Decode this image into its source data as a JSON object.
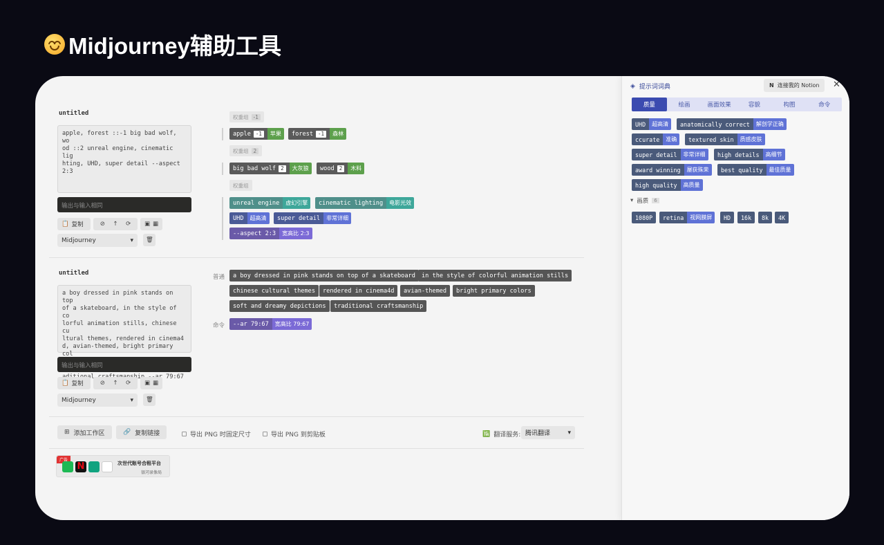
{
  "page_title": "Midjourney辅助工具",
  "colors": {
    "accent": "#3b4bb0",
    "green": "#5da04c",
    "teal": "#3ea79a",
    "blue": "#5f72d6",
    "purple": "#7b6ad6"
  },
  "blocks": [
    {
      "title": "untitled",
      "text": "apple, forest ::-1 big bad wolf, wo\nod ::2 unreal engine, cinematic lig\nhting, UHD, super detail --aspect\n2:3",
      "output_placeholder": "输出与输入相同",
      "copy_label": "复制",
      "model": "Midjourney"
    },
    {
      "title": "untitled",
      "text": "a boy dressed in pink stands on top\nof a skateboard, in the style of co\nlorful animation stills, chinese cu\nltural themes, rendered in cinema4\nd, avian-themed, bright primary col\nors, soft and dreamy depictions, tr\naditional craftsmanship --ar 79:67",
      "output_placeholder": "输出与输入相同",
      "copy_label": "复制",
      "model": "Midjourney"
    }
  ],
  "block1_groups": [
    {
      "label": "权重组",
      "weight": "-1"
    },
    {
      "label": "权重组",
      "weight": "2"
    },
    {
      "label": "权重组",
      "weight": ""
    }
  ],
  "block1_chips": [
    {
      "en": "apple",
      "w": "-1",
      "zh": "苹果"
    },
    {
      "en": "forest",
      "w": "-1",
      "zh": "森林"
    },
    {
      "en": "big bad wolf",
      "w": "2",
      "zh": "大灰狼"
    },
    {
      "en": "wood",
      "w": "2",
      "zh": "木料"
    },
    {
      "en": "unreal engine",
      "zh": "虚幻引擎"
    },
    {
      "en": "cinematic lighting",
      "zh": "电影光效"
    },
    {
      "en": "UHD",
      "zh": "超高清"
    },
    {
      "en": "super detail",
      "zh": "非常详细"
    },
    {
      "en": "--aspect 2:3",
      "zh": "宽高比 2:3"
    }
  ],
  "block2": {
    "normal_label": "普通",
    "command_label": "命令",
    "chips": [
      "a boy dressed in pink stands on top of a skateboard",
      "in the style of colorful animation stills",
      "chinese cultural themes",
      "rendered in cinema4d",
      "avian-themed",
      "bright primary colors",
      "soft and dreamy depictions",
      "traditional craftsmanship"
    ],
    "command": {
      "en": "--ar 79:67",
      "zh": "宽高比 79:67"
    }
  },
  "footer": {
    "add_workspace": "添加工作区",
    "copy_link": "复制链接",
    "export_fixed": "导出 PNG 时固定尺寸",
    "export_clipboard": "导出 PNG 到剪贴板",
    "translate_label": "翻译服务:",
    "translate_value": "腾讯翻译"
  },
  "ad": {
    "tag": "广告",
    "title": "次世代账号合租平台",
    "subtitle": "银河录像局"
  },
  "panel": {
    "title": "提示词词典",
    "notion": "连接我的 Notion",
    "tabs": [
      "质量",
      "绘画",
      "画面效果",
      "容貌",
      "构图",
      "命令"
    ],
    "quality_chips": [
      {
        "en": "UHD",
        "zh": "超高清"
      },
      {
        "en": "anatomically correct",
        "zh": "解剖学正确"
      },
      {
        "en": "ccurate",
        "zh": "准确"
      },
      {
        "en": "textured skin",
        "zh": "质感皮肤"
      },
      {
        "en": "super detail",
        "zh": "非常详细"
      },
      {
        "en": "high details",
        "zh": "高细节"
      },
      {
        "en": "award winning",
        "zh": "屡获殊荣"
      },
      {
        "en": "best quality",
        "zh": "最佳质量"
      },
      {
        "en": "high quality",
        "zh": "高质量"
      }
    ],
    "section": "画质",
    "section_count": "6",
    "res_chips": [
      {
        "en": "1080P",
        "zh": ""
      },
      {
        "en": "retina",
        "zh": "视网膜屏"
      },
      {
        "en": "HD",
        "zh": ""
      },
      {
        "en": "16k",
        "zh": ""
      },
      {
        "en": "8k",
        "zh": ""
      },
      {
        "en": "4K",
        "zh": ""
      }
    ]
  }
}
